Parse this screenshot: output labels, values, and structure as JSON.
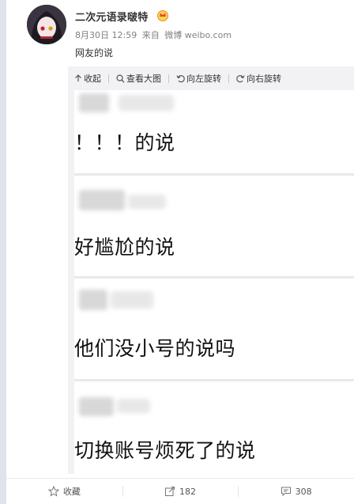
{
  "post": {
    "author": "二次元语录啵特",
    "date": "8月30日 12:59",
    "source_prefix": "来自",
    "source": "微博 weibo.com",
    "text": "网友的说"
  },
  "media_toolbar": {
    "collapse": "收起",
    "view_large": "查看大图",
    "rotate_left": "向左旋转",
    "rotate_right": "向右旋转"
  },
  "screenshot_messages": [
    "！！！的说",
    "好尴尬的说",
    "他们没小号的说吗",
    "切换账号烦死了的说"
  ],
  "actions": {
    "favorite": "收藏",
    "repost_count": "182",
    "comment_count": "308"
  },
  "colors": {
    "background": "#dfe3ea",
    "meta_text": "#808080",
    "media_bg": "#f2f2f5"
  }
}
